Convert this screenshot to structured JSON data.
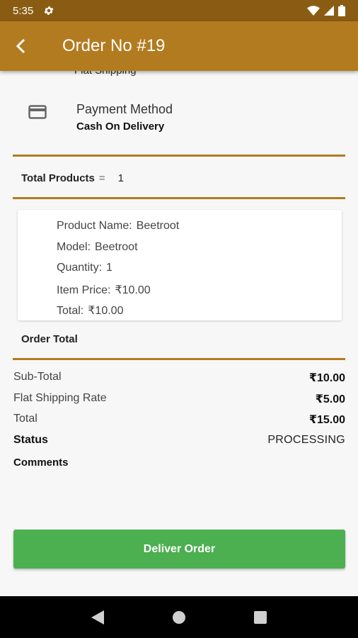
{
  "status_bar": {
    "time": "5:35"
  },
  "app_bar": {
    "title": "Order No #19"
  },
  "cut_off_text": "Flat Shipping",
  "payment": {
    "title": "Payment Method",
    "value": "Cash On Delivery"
  },
  "total_products": {
    "label": "Total Products",
    "separator": "=",
    "value": "1"
  },
  "product": {
    "name_label": "Product Name:",
    "name": "Beetroot",
    "model_label": "Model:",
    "model": "Beetroot",
    "quantity_label": "Quantity:",
    "quantity": "1",
    "price_label": "Item Price:",
    "price": "₹10.00",
    "total_label": "Total:",
    "total": "₹10.00"
  },
  "order_total": {
    "heading": "Order Total"
  },
  "summary": {
    "subtotal_label": "Sub-Total",
    "subtotal": "₹10.00",
    "shipping_label": "Flat Shipping Rate",
    "shipping": "₹5.00",
    "total_label": "Total",
    "total": "₹15.00",
    "status_label": "Status",
    "status": "PROCESSING",
    "comments_label": "Comments"
  },
  "deliver_button": {
    "label": "Deliver Order"
  },
  "colors": {
    "accent": "#b37b20",
    "status_bar": "#8a5c13",
    "button": "#4caf50"
  },
  "icons": {
    "back": "arrow-back-icon",
    "payment": "credit-card-icon",
    "settings": "gear-icon"
  }
}
